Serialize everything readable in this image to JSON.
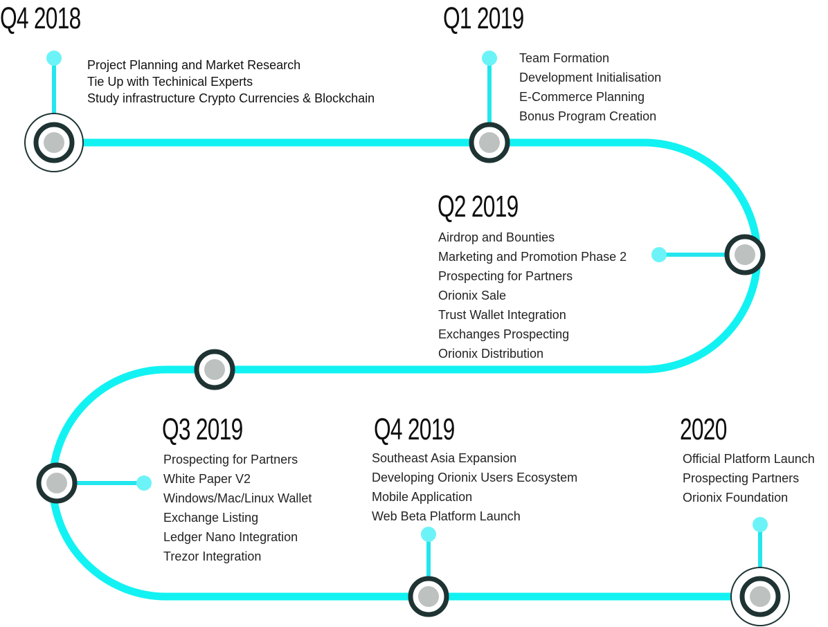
{
  "colors": {
    "track": "#12F2F2",
    "stem": "#23E6EE",
    "stem_dot": "#6CF3F8",
    "node_ring": "#1F3333",
    "node_fill": "#BDC1C0",
    "text": "#222222",
    "heading": "#0D0D0D",
    "background": "#FFFFFF"
  },
  "milestones": [
    {
      "id": "q4-2018",
      "title": "Q4 2018",
      "items": [
        "Project Planning and Market Research",
        "Tie Up with Techinical Experts",
        "Study infrastructure Crypto Currencies & Blockchain"
      ]
    },
    {
      "id": "q1-2019",
      "title": "Q1 2019",
      "items": [
        "Team Formation",
        "Development Initialisation",
        "E-Commerce Planning",
        "Bonus Program Creation"
      ]
    },
    {
      "id": "q2-2019",
      "title": "Q2 2019",
      "items": [
        "Airdrop and Bounties",
        "Marketing and Promotion Phase 2",
        "Prospecting for Partners",
        "Orionix Sale",
        "Trust Wallet Integration",
        "Exchanges Prospecting",
        "Orionix Distribution"
      ]
    },
    {
      "id": "q3-2019",
      "title": "Q3 2019",
      "items": [
        "Prospecting for Partners",
        "White Paper V2",
        "Windows/Mac/Linux Wallet",
        "Exchange Listing",
        "Ledger Nano Integration",
        "Trezor Integration"
      ]
    },
    {
      "id": "q4-2019",
      "title": "Q4 2019",
      "items": [
        "Southeast Asia Expansion",
        "Developing Orionix Users Ecosystem",
        "Mobile Application",
        "Web Beta Platform Launch"
      ]
    },
    {
      "id": "2020",
      "title": "2020",
      "items": [
        "Official Platform Launch",
        "Prospecting Partners",
        "Orionix Foundation"
      ]
    }
  ]
}
